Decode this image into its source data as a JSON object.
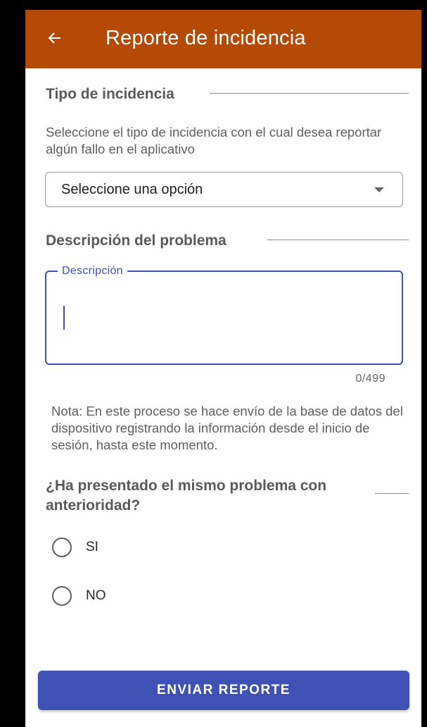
{
  "appbar": {
    "title": "Reporte de incidencia",
    "back_icon": "arrow-left-icon",
    "color": "#b54a04"
  },
  "tipo": {
    "section_title": "Tipo de incidencia",
    "help_text": "Seleccione el tipo de incidencia con el cual desea reportar algún fallo en el aplicativo",
    "select_value": "Seleccione una opción"
  },
  "descripcion": {
    "section_title": "Descripción del problema",
    "field_label": "Descripción",
    "value": "",
    "counter": "0/499",
    "accent": "#3f51b5"
  },
  "note": "Nota: En este proceso se hace envío de la base de datos del dispositivo registrando la información desde el inicio de sesión, hasta este momento.",
  "question": {
    "title": "¿Ha presentado el mismo problema con anterioridad?",
    "options": [
      {
        "label": "SI",
        "selected": false
      },
      {
        "label": "NO",
        "selected": false
      }
    ]
  },
  "submit_label": "ENVIAR REPORTE"
}
